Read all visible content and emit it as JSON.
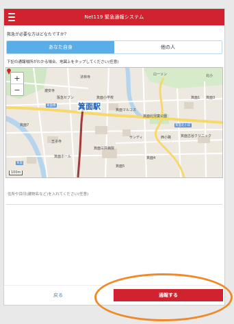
{
  "header": {
    "title": "Net119 緊急通報システム"
  },
  "question": "救急が必要な方はどなたですか？",
  "target_toggle": {
    "self": "あなた自身",
    "other": "他の人"
  },
  "instruction": "下記の通報場所がわかる場合、地図上をタップしてください(任意)",
  "map": {
    "station": "箕面駅",
    "labels": {
      "l1": "法林寺",
      "l2": "ローソン",
      "l3": "瀧安寺",
      "l4": "阪急セブン",
      "l5": "箕面小学校",
      "l6": "箕面マルコス",
      "l7": "箕面北児童公園",
      "l8": "箕面7",
      "l9": "王子寺",
      "l10": "サンディ",
      "l11": "西小路",
      "l12": "箕面古谷クリニック",
      "l13": "箕面ホール",
      "l14": "箕面三井病院",
      "l15": "北小",
      "l16": "箕面1",
      "l17": "箕面5",
      "l18": "箕面3",
      "l19": "箕面4"
    },
    "roads": {
      "r1": "箕面橋",
      "r2": "箕面",
      "r3": "箕面北小前"
    },
    "scale": "100m",
    "zoom_in": "+",
    "zoom_out": "−",
    "colors": {
      "land": "#eee9e0",
      "road": "#ffffff",
      "major_road": "#f6d86b",
      "water": "#b5d4ee",
      "park": "#cfe7c2",
      "rail": "#a33a3a"
    }
  },
  "address": {
    "placeholder": "住所や目印(建物名など)を入れてください(任意)"
  },
  "footer": {
    "back": "戻る",
    "report": "通報する"
  }
}
